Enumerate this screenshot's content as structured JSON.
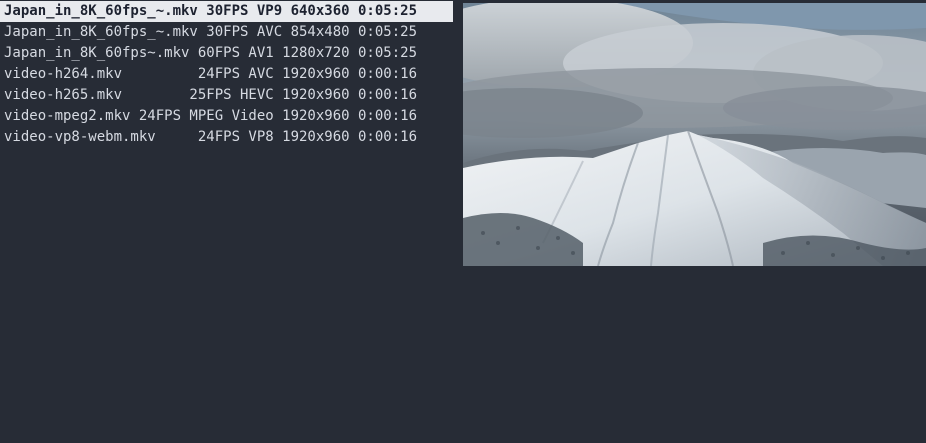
{
  "files": [
    {
      "text": "Japan_in_8K_60fps_~.mkv 30FPS VP9 640x360 0:05:25",
      "selected": true
    },
    {
      "text": "Japan_in_8K_60fps_~.mkv 30FPS AVC 854x480 0:05:25",
      "selected": false
    },
    {
      "text": "Japan_in_8K_60fps~.mkv 60FPS AV1 1280x720 0:05:25",
      "selected": false
    },
    {
      "text": "video-h264.mkv         24FPS AVC 1920x960 0:00:16",
      "selected": false
    },
    {
      "text": "video-h265.mkv        25FPS HEVC 1920x960 0:00:16",
      "selected": false
    },
    {
      "text": "video-mpeg2.mkv 24FPS MPEG Video 1920x960 0:00:16",
      "selected": false
    },
    {
      "text": "video-vp8-webm.mkv     24FPS VP8 1920x960 0:00:16",
      "selected": false
    }
  ],
  "preview": {
    "subject": "snow-covered-mountain-under-cloudy-sky"
  },
  "colors": {
    "background": "#272c36",
    "text": "#d6dae2",
    "selection_bg": "#e8eaee",
    "selection_text": "#1d2230"
  }
}
